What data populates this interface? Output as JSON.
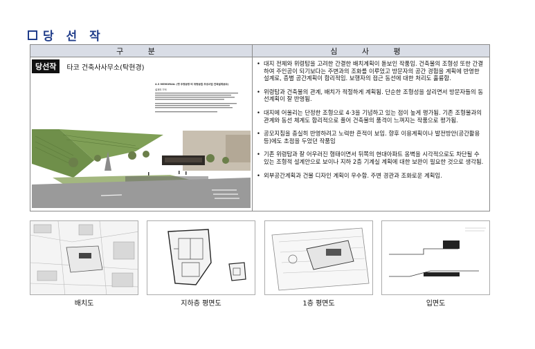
{
  "title": {
    "text": "당 선 작",
    "color": "#1f3c8a"
  },
  "table": {
    "header_left": "구 분",
    "header_right": "심 사 평",
    "winner_badge": "당선작",
    "winner_name": "타코 건축사사무소(탁현경)",
    "board_text": {
      "heading": "4.3 MEMORIAL (옛 주정공장 터 위령공원 조성사업 건축설계공모)",
      "subheading": "설계의 기억"
    },
    "evaluation": [
      "대지 전체와 위령탑을 고려한 간결한 배치계획이 돋보인 작품임. 건축물의 조형성 또한 간결하여 주인공이 되기보다는 주변과의 조화를 이루었고 방문자의 공간 경험을 계획에 반영한 설계로, 층별 공간계획이 합리적임. 보행자의 접근 동선에 대한 처리도 훌륭함.",
      "위령탑과 건축물의 관계, 배치가 적절하게 계획됨. 단순한 조형성을 살리면서 방문자들의 동선계획이 잘 반영됨.",
      "대지에 어울리는 단정한 조형으로 4·3을 기념하고 있는 점이 높게 평가됨. 기존 조형물과의 관계와 동선 체계도 합리적으로 풀어 건축물의 품격이 느껴지는 작품으로 평가됨.",
      "공모지침을 충실히 반영하려고 노력한 흔적이 보임. 향후 이용계획이나 발전방안(공간활용 등)에도 초점을 두었던 작품임",
      "기존 위령탑과 잘 어우러진 형태이면서 뒤쪽의 현대아파트 옹벽을 시각적으로도 차단될 수 있는 조형적 설계안으로 보이나 지하 2층 기계실 계획에 대한 보완이 필요한 것으로 생각됨.",
      "외부공간계획과 건물 디자인 계획이 우수함. 주변 경관과 조화로운 계획임."
    ]
  },
  "drawings": [
    {
      "caption": "배치도"
    },
    {
      "caption": "지하층 평면도"
    },
    {
      "caption": "1층 평면도"
    },
    {
      "caption": "입면도"
    }
  ]
}
